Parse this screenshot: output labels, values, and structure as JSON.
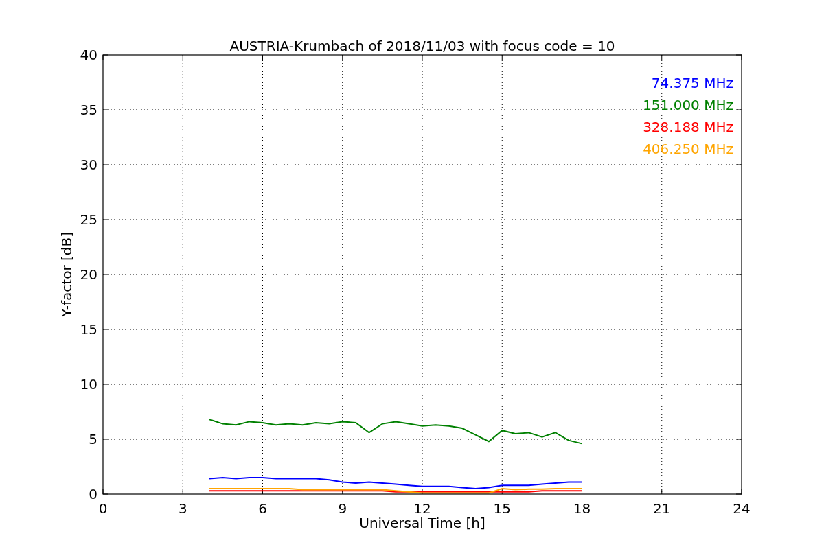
{
  "chart_data": {
    "type": "line",
    "title": "AUSTRIA-Krumbach of 2018/11/03 with focus code = 10",
    "xlabel": "Universal Time [h]",
    "ylabel": "Y-factor [dB]",
    "x": [
      4,
      4.5,
      5,
      5.5,
      6,
      6.5,
      7,
      7.5,
      8,
      8.5,
      9,
      9.5,
      10,
      10.5,
      11,
      11.5,
      12,
      12.5,
      13,
      13.5,
      14,
      14.5,
      15,
      15.5,
      16,
      16.5,
      17,
      17.5,
      18
    ],
    "series": [
      {
        "name": "74.375 MHz",
        "color": "#0000ff",
        "values": [
          1.4,
          1.5,
          1.4,
          1.5,
          1.5,
          1.4,
          1.4,
          1.4,
          1.4,
          1.3,
          1.1,
          1.0,
          1.1,
          1.0,
          0.9,
          0.8,
          0.7,
          0.7,
          0.7,
          0.6,
          0.5,
          0.6,
          0.8,
          0.8,
          0.8,
          0.9,
          1.0,
          1.1,
          1.1
        ]
      },
      {
        "name": "151.000 MHz",
        "color": "#008000",
        "values": [
          6.8,
          6.4,
          6.3,
          6.6,
          6.5,
          6.3,
          6.4,
          6.3,
          6.5,
          6.4,
          6.6,
          6.5,
          5.6,
          6.4,
          6.6,
          6.4,
          6.2,
          6.3,
          6.2,
          6.0,
          5.4,
          4.8,
          5.8,
          5.5,
          5.6,
          5.2,
          5.6,
          4.9,
          4.6
        ]
      },
      {
        "name": "328.188 MHz",
        "color": "#ff0000",
        "values": [
          0.3,
          0.3,
          0.3,
          0.3,
          0.3,
          0.3,
          0.3,
          0.3,
          0.3,
          0.3,
          0.3,
          0.3,
          0.3,
          0.3,
          0.2,
          0.2,
          0.2,
          0.2,
          0.2,
          0.2,
          0.2,
          0.2,
          0.2,
          0.2,
          0.2,
          0.3,
          0.3,
          0.3,
          0.3
        ]
      },
      {
        "name": "406.250 MHz",
        "color": "#ffa500",
        "values": [
          0.5,
          0.5,
          0.5,
          0.5,
          0.5,
          0.5,
          0.5,
          0.4,
          0.4,
          0.4,
          0.4,
          0.4,
          0.4,
          0.4,
          0.3,
          0.2,
          0.1,
          0.1,
          0.1,
          0.1,
          0.1,
          0.1,
          0.5,
          0.4,
          0.45,
          0.45,
          0.5,
          0.5,
          0.5
        ]
      }
    ],
    "grid": true,
    "xlim": [
      0,
      24
    ],
    "ylim": [
      0,
      40
    ],
    "xticks": [
      0,
      3,
      6,
      9,
      12,
      15,
      18,
      21,
      24
    ],
    "yticks": [
      0,
      5,
      10,
      15,
      20,
      25,
      30,
      35,
      40
    ]
  }
}
